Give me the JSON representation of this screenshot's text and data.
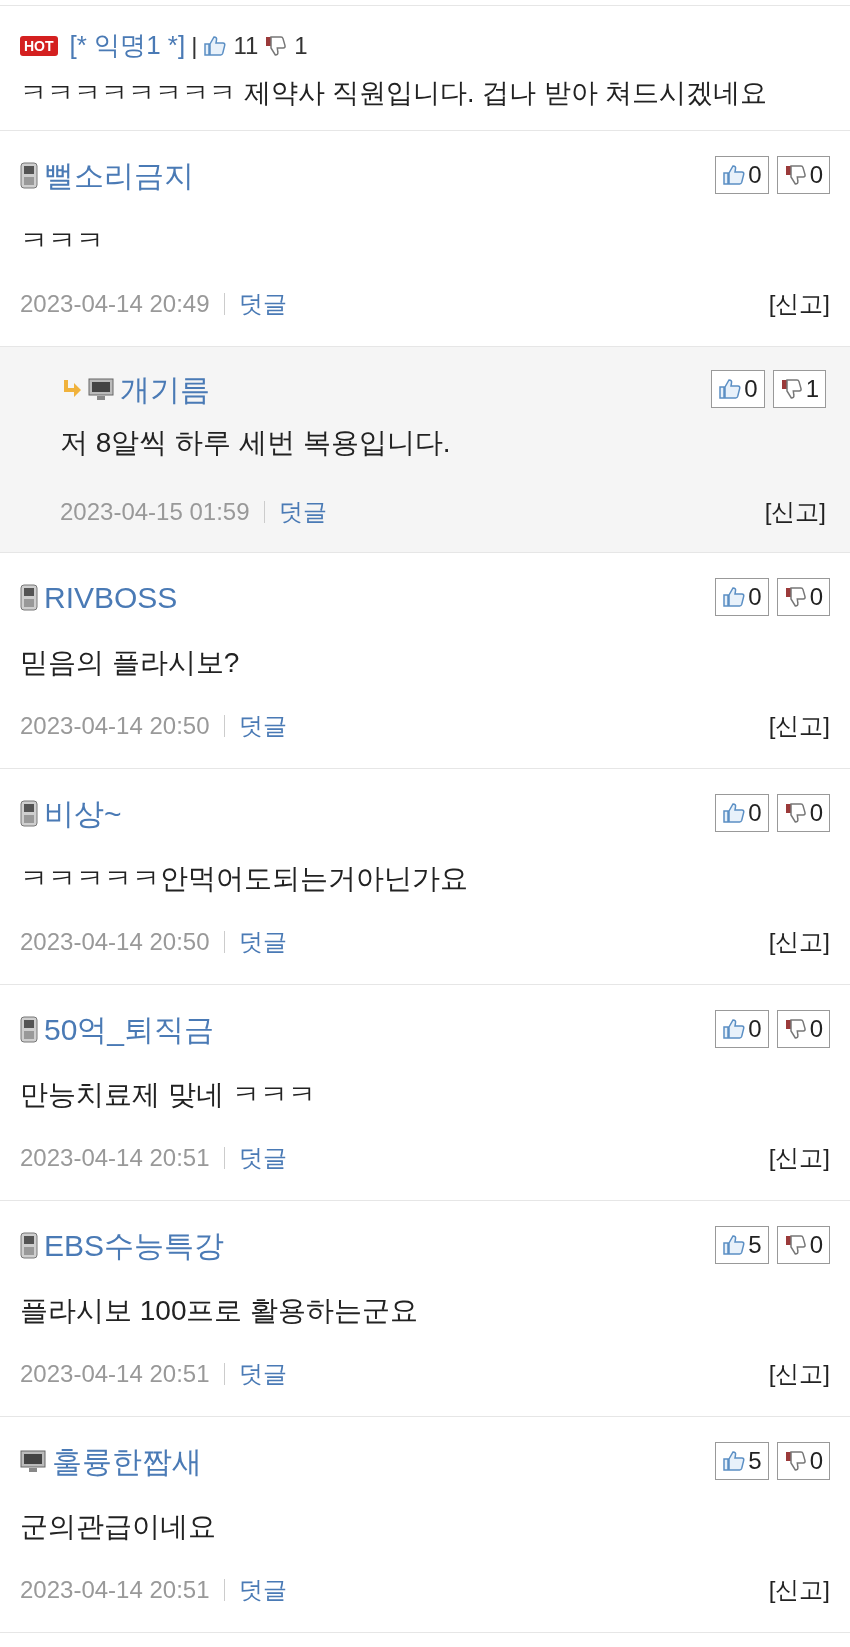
{
  "hot_comment": {
    "badge": "HOT",
    "author": "[* 익명1 *]",
    "separator": "|",
    "likes": "11",
    "dislikes": "1",
    "body": "ㅋㅋㅋㅋㅋㅋㅋㅋ 제약사 직원입니다. 겁나 받아 쳐드시겠네요"
  },
  "comments": [
    {
      "kind": "comment",
      "is_mobile": true,
      "author": "뻘소리금지",
      "likes": "0",
      "dislikes": "0",
      "body": "ㅋㅋㅋ",
      "date": "2023-04-14 20:49",
      "reply": "덧글",
      "report": "[신고]"
    },
    {
      "kind": "reply",
      "is_mobile": false,
      "author": "개기름",
      "likes": "0",
      "dislikes": "1",
      "body": "저 8알씩 하루 세번 복용입니다.",
      "date": "2023-04-15 01:59",
      "reply": "덧글",
      "report": "[신고]"
    },
    {
      "kind": "comment",
      "is_mobile": true,
      "author": "RIVBOSS",
      "likes": "0",
      "dislikes": "0",
      "body": "믿음의 플라시보?",
      "date": "2023-04-14 20:50",
      "reply": "덧글",
      "report": "[신고]"
    },
    {
      "kind": "comment",
      "is_mobile": true,
      "author": "비상~",
      "likes": "0",
      "dislikes": "0",
      "body": "ㅋㅋㅋㅋㅋ안먹어도되는거아닌가요",
      "date": "2023-04-14 20:50",
      "reply": "덧글",
      "report": "[신고]"
    },
    {
      "kind": "comment",
      "is_mobile": true,
      "author": "50억_퇴직금",
      "likes": "0",
      "dislikes": "0",
      "body": "만능치료제 맞네 ㅋㅋㅋ",
      "date": "2023-04-14 20:51",
      "reply": "덧글",
      "report": "[신고]"
    },
    {
      "kind": "comment",
      "is_mobile": true,
      "author": "EBS수능특강",
      "likes": "5",
      "dislikes": "0",
      "body": "플라시보 100프로 활용하는군요",
      "date": "2023-04-14 20:51",
      "reply": "덧글",
      "report": "[신고]"
    },
    {
      "kind": "comment",
      "is_mobile": false,
      "author": "훌륭한짭새",
      "likes": "5",
      "dislikes": "0",
      "body": "군의관급이네요",
      "date": "2023-04-14 20:51",
      "reply": "덧글",
      "report": "[신고]"
    }
  ]
}
